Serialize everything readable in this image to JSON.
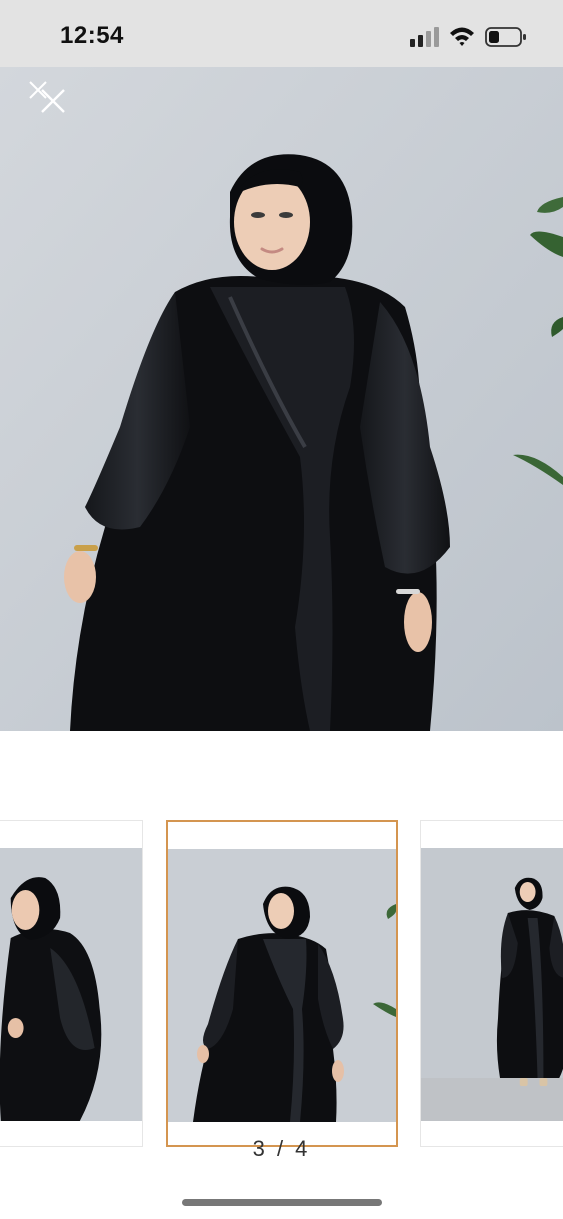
{
  "status_bar": {
    "time": "12:54"
  },
  "gallery": {
    "current_index": 3,
    "total": 4,
    "indicator": "3 / 4",
    "thumbnails": [
      {
        "label": "thumbnail-2",
        "selected": false
      },
      {
        "label": "thumbnail-3",
        "selected": true
      },
      {
        "label": "thumbnail-4",
        "selected": false
      }
    ]
  },
  "colors": {
    "status_bar_bg": "#e3e3e3",
    "selected_thumb_border": "#d49550",
    "photo_wall": "#c9cfd6",
    "dress": "#0d0e11"
  },
  "icons": {
    "close": "close-icon",
    "signal": "cellular-signal-icon",
    "wifi": "wifi-icon",
    "battery": "battery-icon"
  }
}
